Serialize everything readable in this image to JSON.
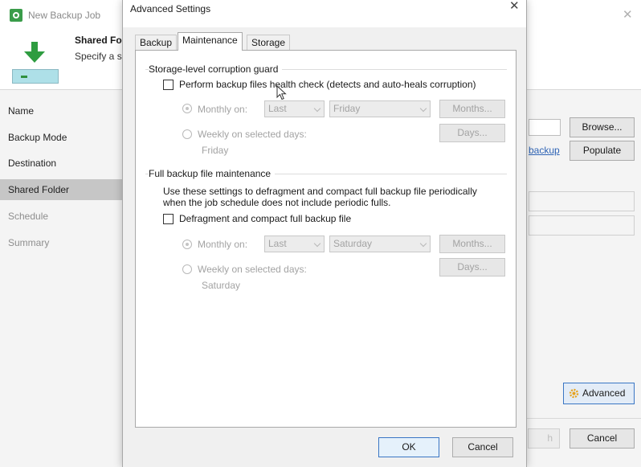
{
  "wizard": {
    "title": "New Backup Job",
    "step_title": "Shared Fo",
    "step_desc": "Specify a s",
    "nav": [
      {
        "label": "Name"
      },
      {
        "label": "Backup Mode"
      },
      {
        "label": "Destination"
      },
      {
        "label": "Shared Folder"
      },
      {
        "label": "Schedule"
      },
      {
        "label": "Summary"
      }
    ],
    "active_nav": "Shared Folder",
    "browse_label": "Browse...",
    "link_label": "backup",
    "populate_label": "Populate",
    "advanced_label": "Advanced",
    "cancel_label": "Cancel",
    "partial_label": "h"
  },
  "dialog": {
    "title": "Advanced Settings",
    "tabs": [
      {
        "label": "Backup"
      },
      {
        "label": "Maintenance"
      },
      {
        "label": "Storage"
      }
    ],
    "active_tab": "Maintenance",
    "storage_guard": {
      "title": "Storage-level corruption guard",
      "checkbox_label": "Perform backup files health check (detects and auto-heals corruption)",
      "checked": false,
      "monthly_label": "Monthly on:",
      "monthly_week": "Last",
      "monthly_day": "Friday",
      "months_button": "Months...",
      "weekly_label": "Weekly on selected days:",
      "days_button": "Days...",
      "weekly_days_value": "Friday"
    },
    "full_maintenance": {
      "title": "Full backup file maintenance",
      "description_line1": "Use these settings to defragment and compact full backup file periodically",
      "description_line2": "when the job schedule does not include periodic fulls.",
      "checkbox_label": "Defragment and compact full backup file",
      "checked": false,
      "monthly_label": "Monthly on:",
      "monthly_week": "Last",
      "monthly_day": "Saturday",
      "months_button": "Months...",
      "weekly_label": "Weekly on selected days:",
      "days_button": "Days...",
      "weekly_days_value": "Saturday"
    },
    "ok_label": "OK",
    "cancel_label": "Cancel"
  },
  "colors": {
    "accent": "#3a76c4",
    "disabled_text": "#a3a3a3",
    "link": "#2f64b5"
  }
}
